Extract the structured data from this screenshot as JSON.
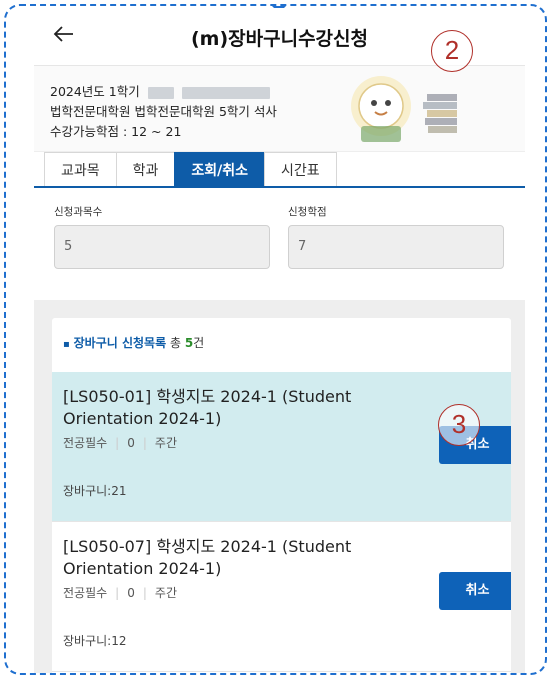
{
  "header": {
    "title": "(m)장바구니수강신청"
  },
  "info": {
    "line1": "2024년도 1학기",
    "line2": "법학전문대학원 법학전문대학원 5학기 석사",
    "line3": "수강가능학점 : 12 ~ 21"
  },
  "tabs": [
    {
      "label": "교과목"
    },
    {
      "label": "학과"
    },
    {
      "label": "조회/취소"
    },
    {
      "label": "시간표"
    }
  ],
  "stats": {
    "courses_label": "신청과목수",
    "courses_value": "5",
    "credits_label": "신청학점",
    "credits_value": "7"
  },
  "list": {
    "bullet": "▪",
    "title": "장바구니 신청목록",
    "total_prefix": "총",
    "total_count": "5",
    "total_suffix": "건",
    "items": [
      {
        "name": "[LS050-01] 학생지도 2024-1 (Student Orientation 2024-1)",
        "type": "전공필수",
        "credit": "0",
        "time": "주간",
        "cart": "장바구니:21",
        "cancel_label": "취소"
      },
      {
        "name": "[LS050-07] 학생지도 2024-1 (Student Orientation 2024-1)",
        "type": "전공필수",
        "credit": "0",
        "time": "주간",
        "cart": "장바구니:12",
        "cancel_label": "취소"
      }
    ]
  },
  "badges": {
    "step2": "2",
    "step3": "3"
  },
  "colors": {
    "accent": "#0e5ca8",
    "selected_row": "#d2ecef",
    "badge_circle": "#b0302a",
    "frame_dash": "#1f6fcf"
  },
  "icons": {
    "back": "arrow-left-icon",
    "mascot": "mascot-reading-icon",
    "books": "books-stack-icon"
  }
}
